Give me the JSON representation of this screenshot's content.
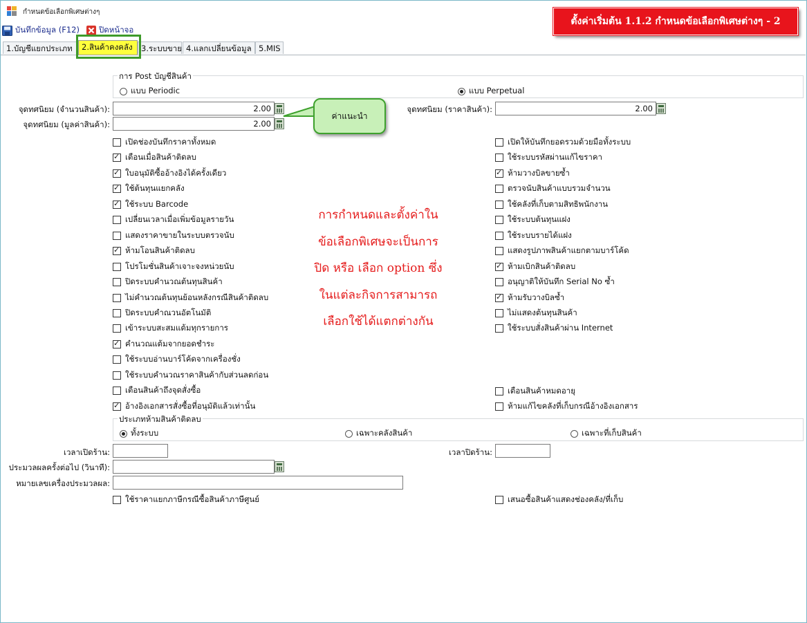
{
  "window": {
    "title": "กำหนดข้อเลือกพิเศษต่างๆ"
  },
  "toolbar": {
    "save_label": "บันทึกข้อมูล (F12)",
    "close_label": "ปิดหน้าจอ"
  },
  "banner": {
    "text": "ตั้งค่าเริ่มต้น 1.1.2  กำหนดข้อเลือกพิเศษต่างๆ  - 2"
  },
  "tabs": [
    {
      "label": "1.บัญชีแยกประเภท",
      "active": false
    },
    {
      "label": "2.สินค้าคงคลัง",
      "active": true
    },
    {
      "label": "3.ระบบขาย",
      "active": false
    },
    {
      "label": "4.แลกเปลี่ยนข้อมูล",
      "active": false
    },
    {
      "label": "5.MIS",
      "active": false
    }
  ],
  "post_group": {
    "title": "การ Post บัญชีสินค้า",
    "options": [
      {
        "label": "แบบ Periodic",
        "selected": false
      },
      {
        "label": "แบบ Perpetual",
        "selected": true
      }
    ]
  },
  "decimals": {
    "qty_label": "จุดทศนิยม (จำนวนสินค้า):",
    "qty_value": "2.00",
    "value_label": "จุดทศนิยม (มูลค่าสินค้า):",
    "value_value": "2.00",
    "price_label": "จุดทศนิยม (ราคาสินค้า):",
    "price_value": "2.00"
  },
  "callout": {
    "text": "ค่าแนะนำ"
  },
  "note": {
    "lines": [
      "การกำหนดและตั้งค่าใน",
      "ข้อเลือกพิเศษจะเป็นการ",
      "ปิด หรือ เลือก option ซึ่ง",
      "ในแต่ละกิจการสามารถ",
      "เลือกใช้ได้แตกต่างกัน"
    ]
  },
  "left_options": [
    {
      "label": "เปิดช่องบันทึกราคาทั้งหมด",
      "checked": false
    },
    {
      "label": "เตือนเมื่อสินค้าติดลบ",
      "checked": true
    },
    {
      "label": "ใบอนุมัติซื้ออ้างอิงได้ครั้งเดียว",
      "checked": true
    },
    {
      "label": "ใช้ต้นทุนแยกคลัง",
      "checked": true
    },
    {
      "label": "ใช้ระบบ Barcode",
      "checked": true
    },
    {
      "label": "เปลี่ยนเวลาเมื่อเพิ่มข้อมูลรายวัน",
      "checked": false
    },
    {
      "label": "แสดงราคาขายในระบบตรวจนับ",
      "checked": false
    },
    {
      "label": "ห้ามโอนสินค้าติดลบ",
      "checked": true
    },
    {
      "label": "โปรโมชั่นสินค้าเจาะจงหน่วยนับ",
      "checked": false
    },
    {
      "label": "ปิดระบบคำนวณต้นทุนสินค้า",
      "checked": false
    },
    {
      "label": "ไม่คำนวณต้นทุนย้อนหลังกรณีสินค้าติดลบ",
      "checked": false
    },
    {
      "label": "ปิดระบบคำณวนอัตโนมัติ",
      "checked": false
    },
    {
      "label": "เข้าระบบสะสมแต้มทุกรายการ",
      "checked": false
    },
    {
      "label": "คำนวณแต้มจากยอดชำระ",
      "checked": true
    },
    {
      "label": "ใช้ระบบอ่านบาร์โค้ดจากเครื่องชั่ง",
      "checked": false
    },
    {
      "label": "ใช้ระบบคำนวณราคาสินค้ากับส่วนลดก่อน",
      "checked": false
    },
    {
      "label": "เตือนสินค้าถึงจุดสั่งซื้อ",
      "checked": false
    },
    {
      "label": "อ้างอิงเอกสารสั่งซื้อที่อนุมัติแล้วเท่านั้น",
      "checked": true
    }
  ],
  "right_options": [
    {
      "label": "เปิดให้บันทึกยอดรวมด้วยมือทั้งระบบ",
      "checked": false
    },
    {
      "label": "ใช้ระบบรหัสผ่านแก้ไขราคา",
      "checked": false
    },
    {
      "label": "ห้ามวางบิลขายซ้ำ",
      "checked": true
    },
    {
      "label": "ตรวจนับสินค้าแบบรวมจำนวน",
      "checked": false
    },
    {
      "label": "ใช้คลังที่เก็บตามสิทธิพนักงาน",
      "checked": false
    },
    {
      "label": "ใช้ระบบต้นทุนแฝง",
      "checked": false
    },
    {
      "label": "ใช้ระบบรายได้แฝง",
      "checked": false
    },
    {
      "label": "แสดงรูปภาพสินค้าแยกตามบาร์โค้ด",
      "checked": false
    },
    {
      "label": "ห้ามเบิกสินค้าติดลบ",
      "checked": true
    },
    {
      "label": "อนุญาติให้บันทึก Serial No ซ้ำ",
      "checked": false
    },
    {
      "label": "ห้ามรับวางบิลซ้ำ",
      "checked": true
    },
    {
      "label": "ไม่แสดงต้นทุนสินค้า",
      "checked": false
    },
    {
      "label": "ใช้ระบบสั่งสินค้าผ่าน Internet",
      "checked": false
    }
  ],
  "right_options_b": [
    {
      "label": "เตือนสินค้าหมดอายุ",
      "checked": false
    },
    {
      "label": "ห้ามแก้ไขคลังที่เก็บกรณีอ้างอิงเอกสาร",
      "checked": false
    }
  ],
  "negative_group": {
    "title": "ประเภทห้ามสินค้าติดลบ",
    "options": [
      {
        "label": "ทั้งระบบ",
        "selected": true
      },
      {
        "label": "เฉพาะคลังสินค้า",
        "selected": false
      },
      {
        "label": "เฉพาะที่เก็บสินค้า",
        "selected": false
      }
    ]
  },
  "store": {
    "open_label": "เวลาเปิดร้าน:",
    "open_value": "",
    "close_label": "เวลาปิดร้าน:",
    "close_value": "",
    "interval_label": "ประมวลผลครั้งต่อไป (วินาที):",
    "interval_value": "",
    "machine_label": "หมายเลขเครื่องประมวลผล:",
    "machine_value": ""
  },
  "bottom_options": [
    {
      "label": "ใช้ราคาแยกภาษีกรณีซื้อสินค้าภาษีศูนย์",
      "checked": false
    },
    {
      "label": "เสนอซื้อสินค้าแสดงช่องคลัง/ที่เก็บ",
      "checked": false
    }
  ],
  "colors": {
    "banner": "#e8141c",
    "active_tab": "#ffff3d",
    "callout_fill": "#c8f0b8",
    "callout_border": "#3ea12d",
    "note_text": "#e51b1b"
  }
}
